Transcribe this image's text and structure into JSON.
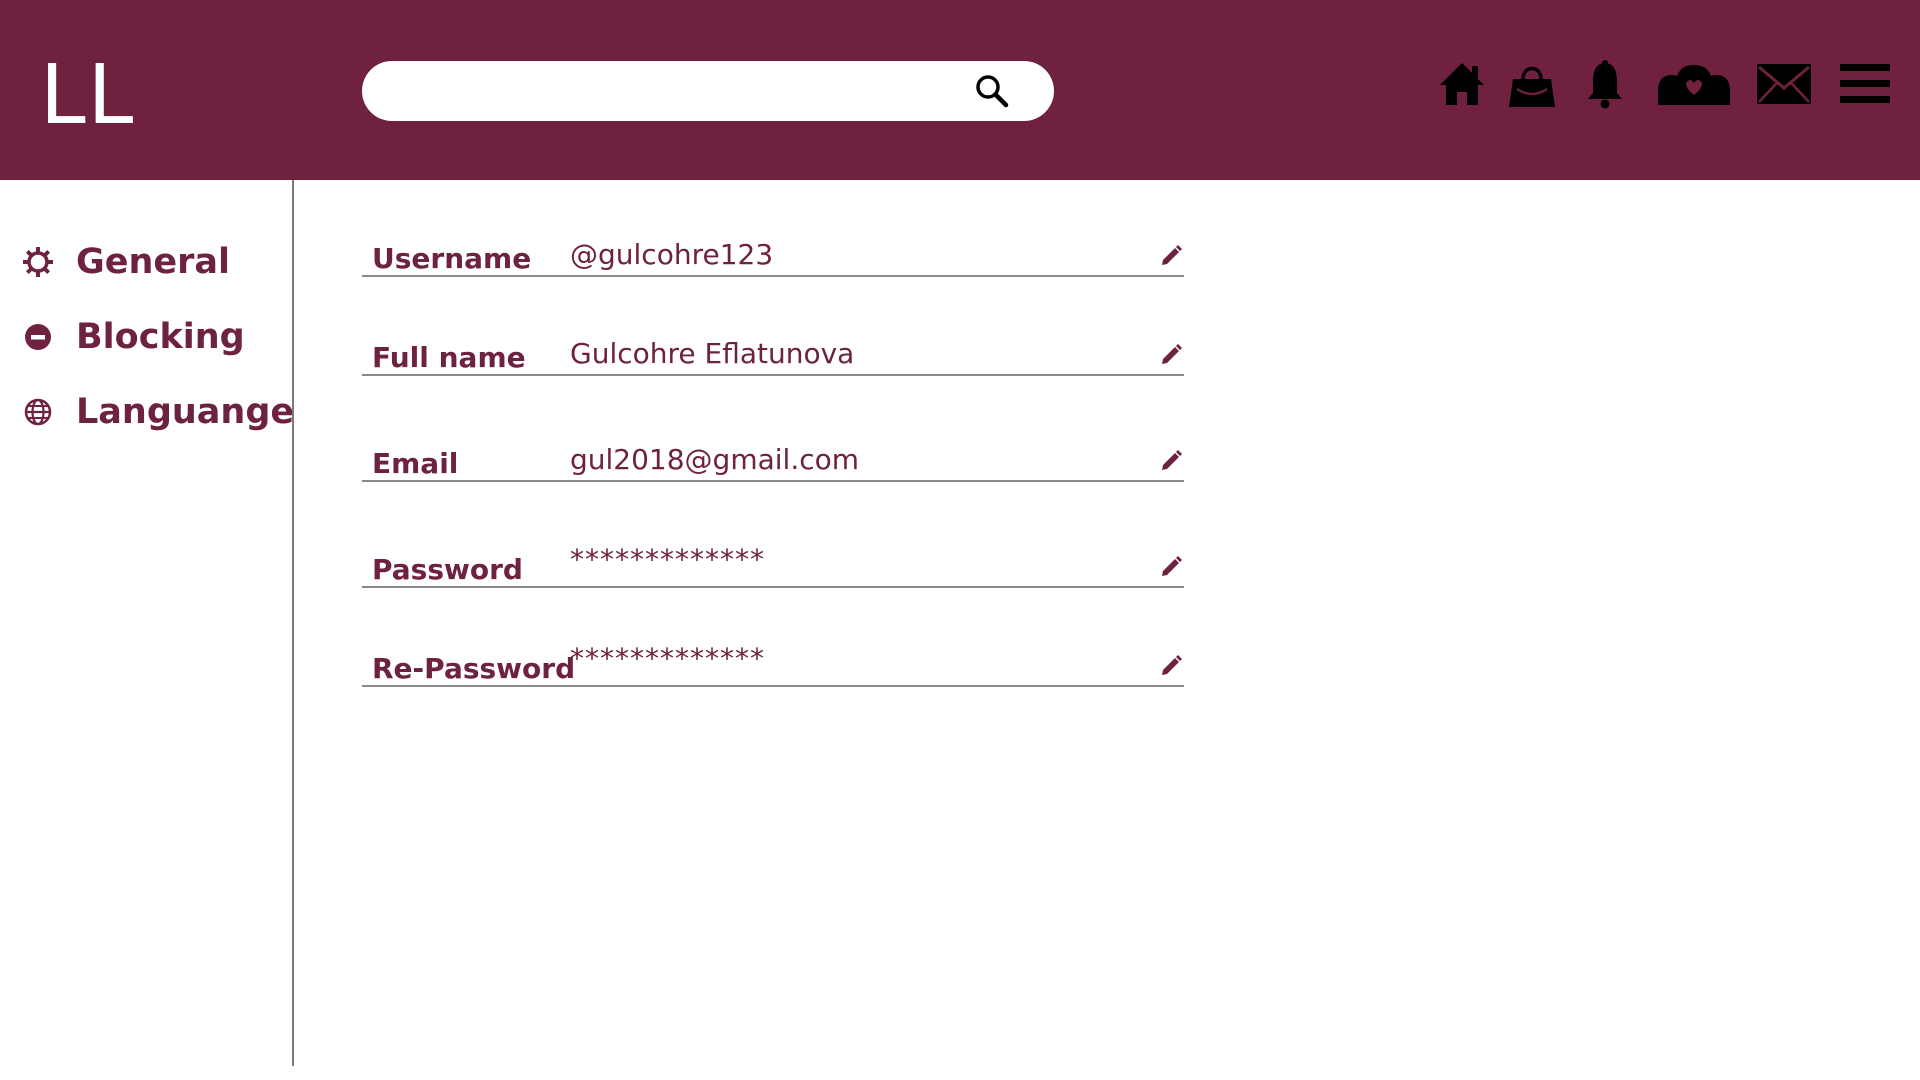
{
  "header": {
    "logo_text": "LL",
    "search": {
      "value": "",
      "placeholder": ""
    },
    "icons": [
      "home-icon",
      "shopping-bag-icon",
      "bell-icon",
      "friends-icon",
      "mail-icon",
      "menu-icon"
    ],
    "brand_color": "#70213f"
  },
  "sidebar": {
    "items": [
      {
        "label": "General",
        "icon": "gear-icon"
      },
      {
        "label": "Blocking",
        "icon": "minus-circle-icon"
      },
      {
        "label": "Languange",
        "icon": "globe-icon"
      }
    ]
  },
  "form": {
    "fields": [
      {
        "label": "Username",
        "value": "@gulcohre123"
      },
      {
        "label": "Full name",
        "value": "Gulcohre Eflatunova"
      },
      {
        "label": "Email",
        "value": "gul2018@gmail.com"
      },
      {
        "label": "Password",
        "value": "*************"
      },
      {
        "label": "Re-Password",
        "value": "*************"
      }
    ],
    "accent_color": "#6d2241"
  }
}
